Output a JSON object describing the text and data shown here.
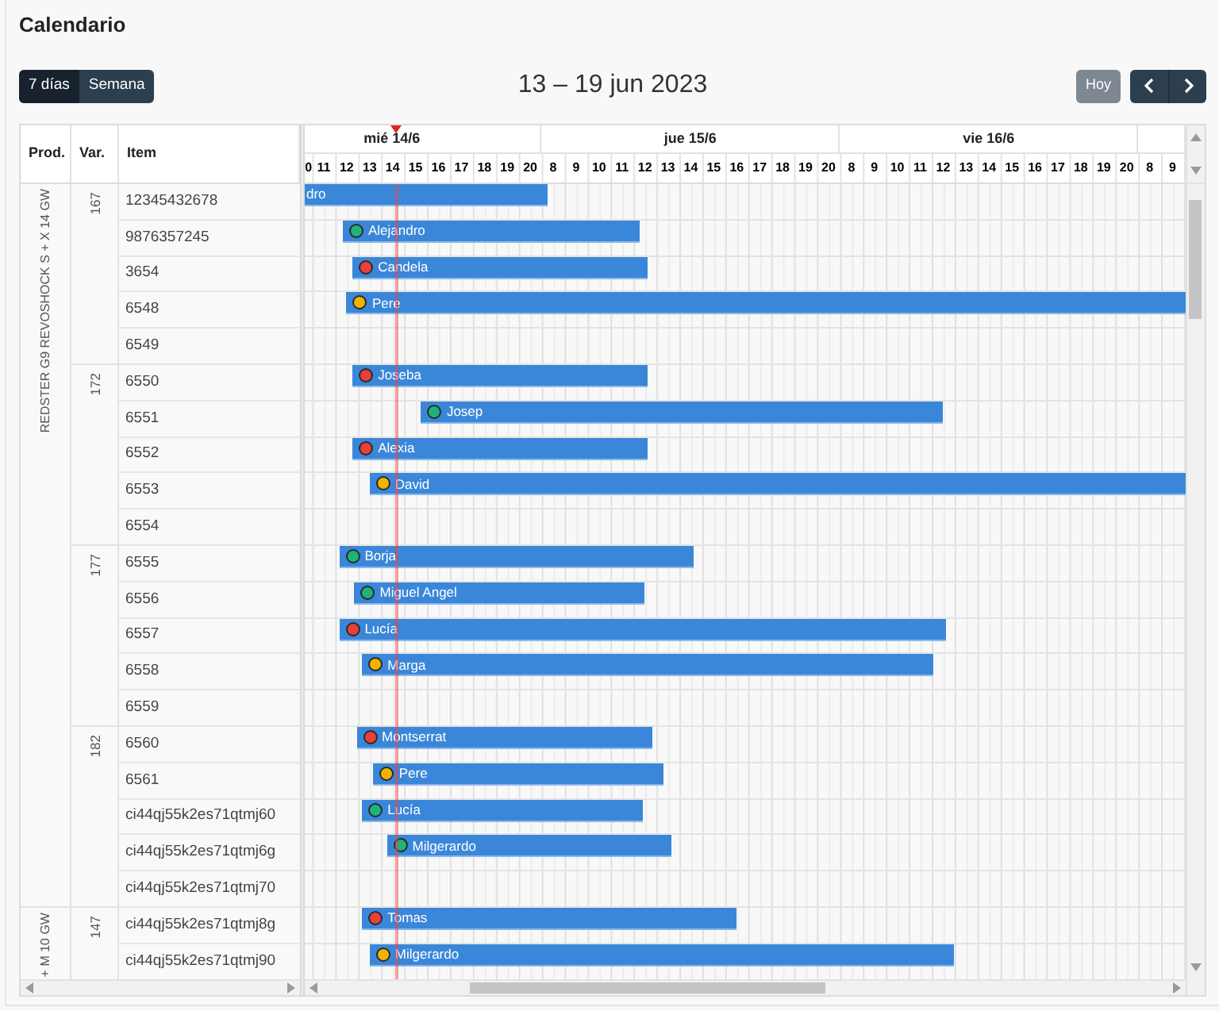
{
  "title": "Calendario",
  "toolbar": {
    "views": [
      {
        "label": "7 días",
        "selected": true
      },
      {
        "label": "Semana",
        "selected": false
      }
    ],
    "range_title": "13 – 19 jun 2023",
    "today_button": {
      "label": "Hoy",
      "disabled": true
    }
  },
  "table": {
    "columns": [
      "Prod.",
      "Var.",
      "Item"
    ],
    "products": [
      {
        "name": "REDSTER G9 REVOSHOCK S + X 14 GW",
        "variants": [
          {
            "name": "167",
            "items": [
              {
                "code": "12345432678",
                "task": {
                  "name": "dro"
                }
              },
              {
                "code": "9876357245",
                "task": {
                  "name": "Alejandro",
                  "color": "#1fb27a"
                }
              },
              {
                "code": "3654",
                "task": {
                  "name": "Candela",
                  "color": "#e8403a"
                }
              },
              {
                "code": "6548",
                "task": {
                  "name": "Pere",
                  "color": "#f0b400"
                }
              },
              {
                "code": "6549"
              }
            ]
          },
          {
            "name": "172",
            "items": [
              {
                "code": "6550",
                "task": {
                  "name": "Joseba",
                  "color": "#e8403a"
                }
              },
              {
                "code": "6551",
                "task": {
                  "name": "Josep",
                  "color": "#1fb27a"
                }
              },
              {
                "code": "6552",
                "task": {
                  "name": "Alexia",
                  "color": "#e8403a"
                }
              },
              {
                "code": "6553",
                "task": {
                  "name": "David",
                  "color": "#f0b400"
                }
              },
              {
                "code": "6554"
              }
            ]
          },
          {
            "name": "177",
            "items": [
              {
                "code": "6555",
                "task": {
                  "name": "Borja",
                  "color": "#1fb27a"
                }
              },
              {
                "code": "6556",
                "task": {
                  "name": "Miguel Angel",
                  "color": "#1fb27a"
                }
              },
              {
                "code": "6557",
                "task": {
                  "name": "Lucía",
                  "color": "#e8403a"
                }
              },
              {
                "code": "6558",
                "task": {
                  "name": "Marga",
                  "color": "#f0b400"
                }
              },
              {
                "code": "6559"
              }
            ]
          },
          {
            "name": "182",
            "items": [
              {
                "code": "6560",
                "task": {
                  "name": "Montserrat",
                  "color": "#e8403a"
                }
              },
              {
                "code": "6561",
                "task": {
                  "name": "Pere",
                  "color": "#f0b400"
                }
              },
              {
                "code": "ci44qj55k2es71qtmj60",
                "task": {
                  "name": "Lucía",
                  "color": "#1fb27a"
                }
              },
              {
                "code": "ci44qj55k2es71qtmj6g",
                "task": {
                  "name": "Milgerardo",
                  "color": "#1fb27a"
                }
              },
              {
                "code": "ci44qj55k2es71qtmj70"
              }
            ]
          }
        ]
      },
      {
        "name": "+ M 10 GW",
        "variants": [
          {
            "name": "147",
            "items": [
              {
                "code": "ci44qj55k2es71qtmj8g",
                "task": {
                  "name": "Tomas",
                  "color": "#e8403a"
                }
              },
              {
                "code": "ci44qj55k2es71qtmj90",
                "task": {
                  "name": "Milgerardo",
                  "color": "#f0b400"
                }
              }
            ]
          }
        ]
      }
    ]
  },
  "timeline": {
    "days": [
      {
        "label": "mié 14/6",
        "hours": [
          "0",
          "11",
          "12",
          "13",
          "14",
          "15",
          "16",
          "17",
          "18",
          "19",
          "20"
        ]
      },
      {
        "label": "jue 15/6",
        "hours": [
          "8",
          "9",
          "10",
          "11",
          "12",
          "13",
          "14",
          "15",
          "16",
          "17",
          "18",
          "19",
          "20"
        ]
      },
      {
        "label": "vie 16/6",
        "hours": [
          "8",
          "9",
          "10",
          "11",
          "12",
          "13",
          "14",
          "15",
          "16",
          "17",
          "18",
          "19",
          "20"
        ]
      },
      {
        "hours": [
          "8",
          "9"
        ]
      }
    ]
  }
}
